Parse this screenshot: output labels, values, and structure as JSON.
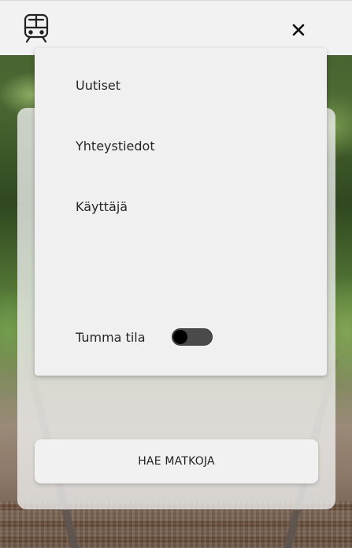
{
  "navbar": {
    "logo_icon": "train-icon",
    "close_icon": "close-icon"
  },
  "menu": {
    "items": [
      {
        "label": "Uutiset"
      },
      {
        "label": "Yhteystiedot"
      },
      {
        "label": "Käyttäjä"
      }
    ],
    "dark_mode": {
      "label": "Tumma tila",
      "enabled": false
    }
  },
  "search": {
    "button_label": "HAE MATKOJA"
  },
  "colors": {
    "panel": "#f0f0f0",
    "toggle_track": "#4a4a4a",
    "toggle_knob": "#000000",
    "text": "#262626"
  }
}
